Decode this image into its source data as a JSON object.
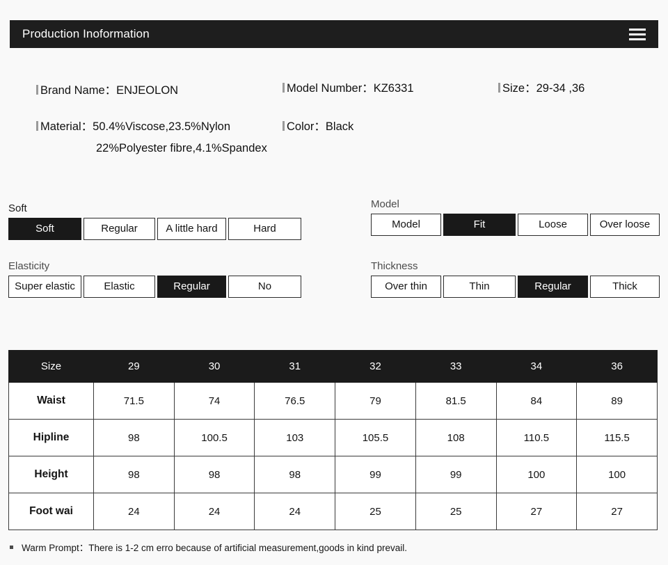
{
  "header": {
    "title": "Production Inoformation",
    "menu_icon": "hamburger-icon",
    "background": "#1e1e1e",
    "text_color": "#ffffff"
  },
  "info": {
    "brand_name": "Brand Name：ENJEOLON",
    "model_number": "Model Number：KZ6331",
    "size": "Size：29-34 ,36",
    "material": "Material：50.4%Viscose,23.5%Nylon",
    "material_line2": "22%Polyester fibre,4.1%Spandex",
    "color": "Color：Black"
  },
  "attributes": [
    {
      "label": "Soft",
      "options": [
        "Soft",
        "Regular",
        "A little hard",
        "Hard"
      ],
      "selected": "Soft"
    },
    {
      "label": "Model",
      "options": [
        "Model",
        "Fit",
        "Loose",
        "Over loose"
      ],
      "selected": "Fit"
    },
    {
      "label": "Elasticity",
      "options": [
        "Super elastic",
        "Elastic",
        "Regular",
        "No"
      ],
      "selected": "Regular"
    },
    {
      "label": "Thickness",
      "options": [
        "Over thin",
        "Thin",
        "Regular",
        "Thick"
      ],
      "selected": "Regular"
    }
  ],
  "size_table": {
    "columns": [
      "Size",
      "29",
      "30",
      "31",
      "32",
      "33",
      "34",
      "36"
    ],
    "rows": [
      {
        "label": "Waist",
        "values": [
          "71.5",
          "74",
          "76.5",
          "79",
          "81.5",
          "84",
          "89"
        ]
      },
      {
        "label": "Hipline",
        "values": [
          "98",
          "100.5",
          "103",
          "105.5",
          "108",
          "110.5",
          "115.5"
        ]
      },
      {
        "label": "Height",
        "values": [
          "98",
          "98",
          "98",
          "99",
          "99",
          "100",
          "100"
        ]
      },
      {
        "label": "Foot wai",
        "values": [
          "24",
          "24",
          "24",
          "25",
          "25",
          "27",
          "27"
        ]
      }
    ]
  },
  "footer": {
    "note": "Warm Prompt：There is 1-2 cm erro because of artificial measurement,goods in kind prevail."
  },
  "colors": {
    "page_background": "#f9f9f9",
    "accent_dark": "#1b1b1b",
    "border": "#3a3a3a",
    "label_gray": "#4c4c4c"
  }
}
